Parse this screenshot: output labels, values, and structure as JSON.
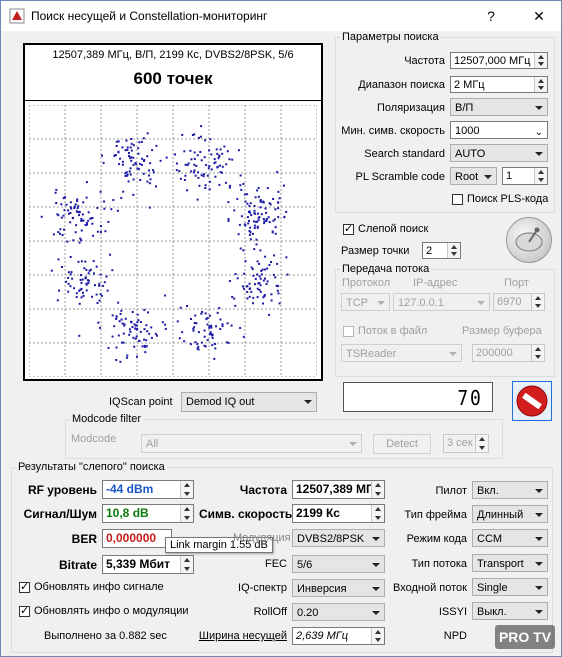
{
  "titlebar": {
    "title": "Поиск несущей и Constellation-мониторинг",
    "help": "?",
    "close": "✕"
  },
  "plot": {
    "info": "12507,389 МГц, В/П, 2199 Кс, DVBS2/8PSK, 5/6",
    "points_label": "600 точек",
    "dot_color": "#1a1aa6"
  },
  "search_params": {
    "legend": "Параметры поиска",
    "freq_label": "Частота",
    "freq_value": "12507,000 МГц",
    "range_label": "Диапазон поиска",
    "range_value": "2 МГц",
    "pol_label": "Поляризация",
    "pol_value": "В/П",
    "minsr_label": "Мин. симв. скорость",
    "minsr_value": "1000",
    "standard_label": "Search standard",
    "standard_value": "AUTO",
    "pls_label": "PL Scramble code",
    "pls_mode": "Root",
    "pls_value": "1",
    "pls_search_label": "Поиск PLS-кода"
  },
  "blind": {
    "label": "Слепой поиск",
    "dot_size_label": "Размер точки",
    "dot_size_value": "2"
  },
  "stream": {
    "legend": "Передача потока",
    "proto_label": "Протокол",
    "ip_label": "IP-адрес",
    "port_label": "Порт",
    "proto_value": "TCP",
    "ip_value": "127.0.0.1",
    "port_value": "6970",
    "file_label": "Поток в файл",
    "buf_label": "Размер буфера",
    "reader_value": "TSReader",
    "buf_value": "200000"
  },
  "lcd_value": "70",
  "iq": {
    "label": "IQScan point",
    "value": "Demod IQ out"
  },
  "modcode": {
    "legend": "Modcode filter",
    "label": "Modcode",
    "value": "All",
    "detect": "Detect",
    "time": "3 сек"
  },
  "results": {
    "legend": "Результаты \"слепого\" поиска",
    "rf_label": "RF уровень",
    "rf_value": "-44 dBm",
    "rf_color": "#1a56c8",
    "snr_label": "Сигнал/Шум",
    "snr_value": "10,8 dB",
    "snr_color": "#0a7a0a",
    "ber_label": "BER",
    "ber_value": "0,000000",
    "ber_color": "#c81a1a",
    "bitrate_label": "Bitrate",
    "bitrate_value": "5,339 Мбит",
    "tooltip": "Link margin 1.55 dB",
    "freq_label": "Частота",
    "freq_value": "12507,389 МГ",
    "sr_label": "Симв. скорость",
    "sr_value": "2199 Кс",
    "mod_label": "Модуляция",
    "mod_value": "DVBS2/8PSK",
    "fec_label": "FEC",
    "fec_value": "5/6",
    "iqspec_label": "IQ-спектр",
    "iqspec_value": "Инверсия",
    "rolloff_label": "RollOff",
    "rolloff_value": "0.20",
    "bw_label": "Ширина несущей",
    "bw_value": "2,639 МГц",
    "pilot_label": "Пилот",
    "pilot_value": "Вкл.",
    "frame_label": "Тип фрейма",
    "frame_value": "Длинный",
    "codemode_label": "Режим кода",
    "codemode_value": "CCM",
    "streamtype_label": "Тип потока",
    "streamtype_value": "Transport",
    "input_label": "Входной поток",
    "input_value": "Single",
    "issyi_label": "ISSYI",
    "issyi_value": "Выкл.",
    "npd_label": "NPD",
    "upd_signal_label": "Обновлять инфо сигнале",
    "upd_mod_label": "Обновлять инфо о модуляции",
    "done_label": "Выполнено за 0.882 sec"
  },
  "watermark": "PRO TV"
}
